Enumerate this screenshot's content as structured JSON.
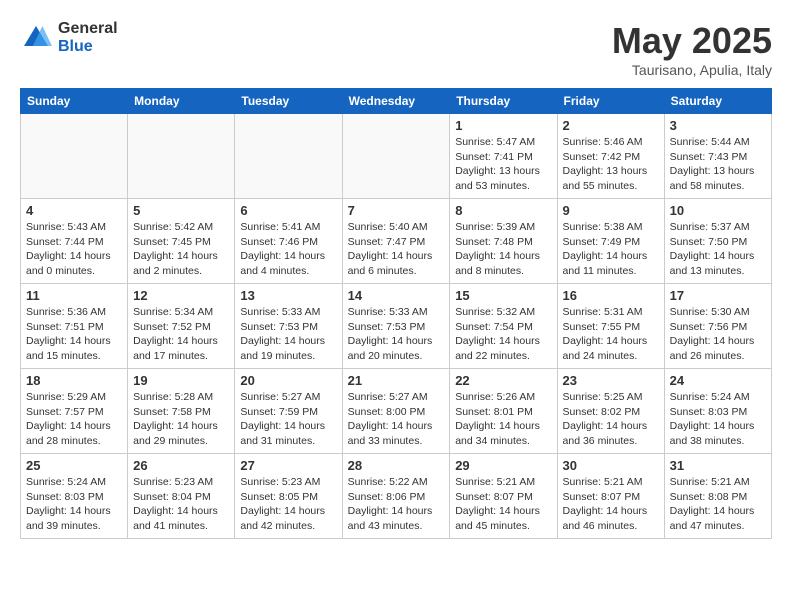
{
  "header": {
    "logo_general": "General",
    "logo_blue": "Blue",
    "month_title": "May 2025",
    "location": "Taurisano, Apulia, Italy"
  },
  "calendar": {
    "days_of_week": [
      "Sunday",
      "Monday",
      "Tuesday",
      "Wednesday",
      "Thursday",
      "Friday",
      "Saturday"
    ],
    "weeks": [
      [
        {
          "day": "",
          "info": ""
        },
        {
          "day": "",
          "info": ""
        },
        {
          "day": "",
          "info": ""
        },
        {
          "day": "",
          "info": ""
        },
        {
          "day": "1",
          "info": "Sunrise: 5:47 AM\nSunset: 7:41 PM\nDaylight: 13 hours\nand 53 minutes."
        },
        {
          "day": "2",
          "info": "Sunrise: 5:46 AM\nSunset: 7:42 PM\nDaylight: 13 hours\nand 55 minutes."
        },
        {
          "day": "3",
          "info": "Sunrise: 5:44 AM\nSunset: 7:43 PM\nDaylight: 13 hours\nand 58 minutes."
        }
      ],
      [
        {
          "day": "4",
          "info": "Sunrise: 5:43 AM\nSunset: 7:44 PM\nDaylight: 14 hours\nand 0 minutes."
        },
        {
          "day": "5",
          "info": "Sunrise: 5:42 AM\nSunset: 7:45 PM\nDaylight: 14 hours\nand 2 minutes."
        },
        {
          "day": "6",
          "info": "Sunrise: 5:41 AM\nSunset: 7:46 PM\nDaylight: 14 hours\nand 4 minutes."
        },
        {
          "day": "7",
          "info": "Sunrise: 5:40 AM\nSunset: 7:47 PM\nDaylight: 14 hours\nand 6 minutes."
        },
        {
          "day": "8",
          "info": "Sunrise: 5:39 AM\nSunset: 7:48 PM\nDaylight: 14 hours\nand 8 minutes."
        },
        {
          "day": "9",
          "info": "Sunrise: 5:38 AM\nSunset: 7:49 PM\nDaylight: 14 hours\nand 11 minutes."
        },
        {
          "day": "10",
          "info": "Sunrise: 5:37 AM\nSunset: 7:50 PM\nDaylight: 14 hours\nand 13 minutes."
        }
      ],
      [
        {
          "day": "11",
          "info": "Sunrise: 5:36 AM\nSunset: 7:51 PM\nDaylight: 14 hours\nand 15 minutes."
        },
        {
          "day": "12",
          "info": "Sunrise: 5:34 AM\nSunset: 7:52 PM\nDaylight: 14 hours\nand 17 minutes."
        },
        {
          "day": "13",
          "info": "Sunrise: 5:33 AM\nSunset: 7:53 PM\nDaylight: 14 hours\nand 19 minutes."
        },
        {
          "day": "14",
          "info": "Sunrise: 5:33 AM\nSunset: 7:53 PM\nDaylight: 14 hours\nand 20 minutes."
        },
        {
          "day": "15",
          "info": "Sunrise: 5:32 AM\nSunset: 7:54 PM\nDaylight: 14 hours\nand 22 minutes."
        },
        {
          "day": "16",
          "info": "Sunrise: 5:31 AM\nSunset: 7:55 PM\nDaylight: 14 hours\nand 24 minutes."
        },
        {
          "day": "17",
          "info": "Sunrise: 5:30 AM\nSunset: 7:56 PM\nDaylight: 14 hours\nand 26 minutes."
        }
      ],
      [
        {
          "day": "18",
          "info": "Sunrise: 5:29 AM\nSunset: 7:57 PM\nDaylight: 14 hours\nand 28 minutes."
        },
        {
          "day": "19",
          "info": "Sunrise: 5:28 AM\nSunset: 7:58 PM\nDaylight: 14 hours\nand 29 minutes."
        },
        {
          "day": "20",
          "info": "Sunrise: 5:27 AM\nSunset: 7:59 PM\nDaylight: 14 hours\nand 31 minutes."
        },
        {
          "day": "21",
          "info": "Sunrise: 5:27 AM\nSunset: 8:00 PM\nDaylight: 14 hours\nand 33 minutes."
        },
        {
          "day": "22",
          "info": "Sunrise: 5:26 AM\nSunset: 8:01 PM\nDaylight: 14 hours\nand 34 minutes."
        },
        {
          "day": "23",
          "info": "Sunrise: 5:25 AM\nSunset: 8:02 PM\nDaylight: 14 hours\nand 36 minutes."
        },
        {
          "day": "24",
          "info": "Sunrise: 5:24 AM\nSunset: 8:03 PM\nDaylight: 14 hours\nand 38 minutes."
        }
      ],
      [
        {
          "day": "25",
          "info": "Sunrise: 5:24 AM\nSunset: 8:03 PM\nDaylight: 14 hours\nand 39 minutes."
        },
        {
          "day": "26",
          "info": "Sunrise: 5:23 AM\nSunset: 8:04 PM\nDaylight: 14 hours\nand 41 minutes."
        },
        {
          "day": "27",
          "info": "Sunrise: 5:23 AM\nSunset: 8:05 PM\nDaylight: 14 hours\nand 42 minutes."
        },
        {
          "day": "28",
          "info": "Sunrise: 5:22 AM\nSunset: 8:06 PM\nDaylight: 14 hours\nand 43 minutes."
        },
        {
          "day": "29",
          "info": "Sunrise: 5:21 AM\nSunset: 8:07 PM\nDaylight: 14 hours\nand 45 minutes."
        },
        {
          "day": "30",
          "info": "Sunrise: 5:21 AM\nSunset: 8:07 PM\nDaylight: 14 hours\nand 46 minutes."
        },
        {
          "day": "31",
          "info": "Sunrise: 5:21 AM\nSunset: 8:08 PM\nDaylight: 14 hours\nand 47 minutes."
        }
      ]
    ]
  }
}
